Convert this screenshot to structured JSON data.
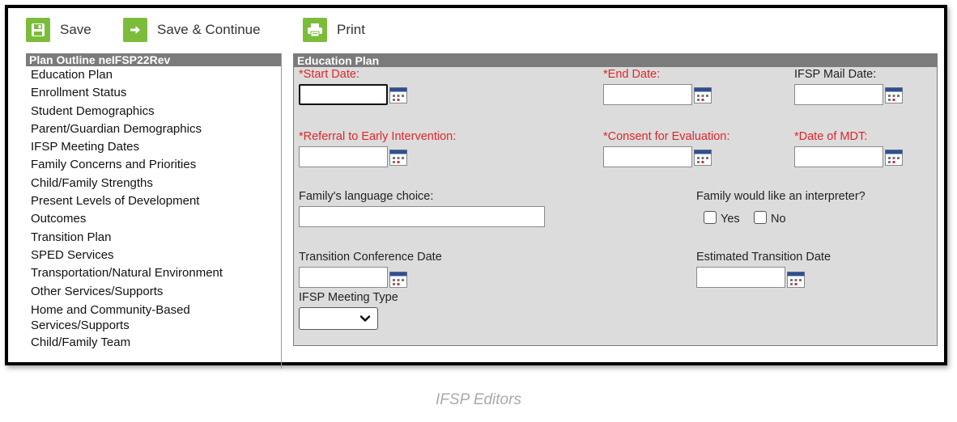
{
  "toolbar": {
    "save_label": "Save",
    "save_continue_label": "Save & Continue",
    "print_label": "Print"
  },
  "outline": {
    "header": "Plan Outline neIFSP22Rev",
    "items": [
      "Education Plan",
      "Enrollment Status",
      "Student Demographics",
      "Parent/Guardian Demographics",
      "IFSP Meeting Dates",
      "Family Concerns and Priorities",
      "Child/Family Strengths",
      "Present Levels of Development",
      "Outcomes",
      "Transition Plan",
      "SPED Services",
      "Transportation/Natural Environment",
      "Other Services/Supports",
      "Home and Community-Based Services/Supports",
      "Child/Family Team"
    ]
  },
  "form": {
    "header": "Education Plan",
    "start_date_label": "*Start Date:",
    "start_date_value": "",
    "end_date_label": "*End Date:",
    "end_date_value": "",
    "mail_date_label": "IFSP Mail Date:",
    "mail_date_value": "",
    "referral_label": "*Referral to Early Intervention:",
    "referral_value": "",
    "consent_label": "*Consent for Evaluation:",
    "consent_value": "",
    "mdt_label": "*Date of MDT:",
    "mdt_value": "",
    "language_label": "Family's language choice:",
    "language_value": "",
    "interpreter_label": "Family would like an interpreter?",
    "yes_label": "Yes",
    "no_label": "No",
    "transition_conf_label": "Transition Conference Date",
    "transition_conf_value": "",
    "est_transition_label": "Estimated Transition Date",
    "est_transition_value": "",
    "meeting_type_label": "IFSP Meeting Type",
    "meeting_type_value": ""
  },
  "caption": "IFSP Editors",
  "colors": {
    "accent_green": "#7bbd3a",
    "panel_header": "#7b7b7b",
    "required_red": "#e0262c",
    "form_bg": "#dcdcdc"
  },
  "icons": {
    "save": "floppy-disk-icon",
    "save_continue": "arrow-right-icon",
    "print": "printer-icon",
    "calendar": "calendar-icon",
    "dropdown": "chevron-down-icon"
  }
}
